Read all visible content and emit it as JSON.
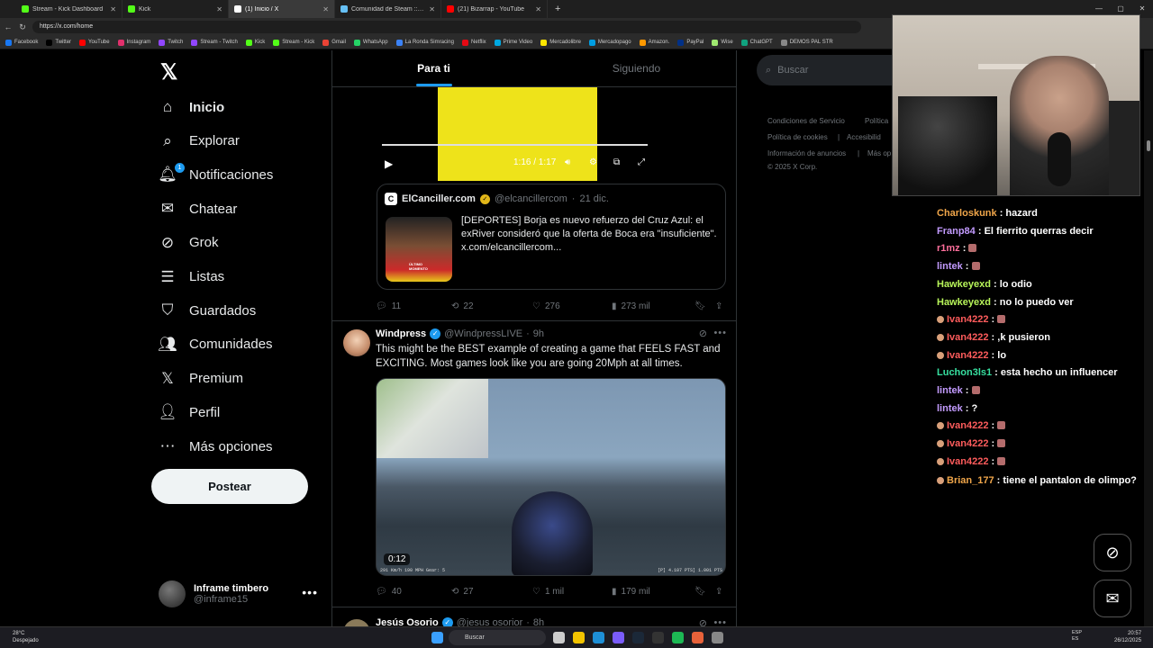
{
  "browser": {
    "tabs": [
      {
        "title": "Stream - Kick Dashboard",
        "active": false,
        "color": "#53fc18"
      },
      {
        "title": "Kick",
        "active": false,
        "color": "#53fc18"
      },
      {
        "title": "(1) Inicio / X",
        "active": true,
        "color": "#ffffff"
      },
      {
        "title": "Comunidad de Steam :: ojo",
        "active": false,
        "color": "#66c0f4"
      },
      {
        "title": "(21) Bizarrap - YouTube",
        "active": false,
        "color": "#ff0000"
      }
    ],
    "url": "https://x.com/home",
    "bookmarks": [
      {
        "label": "Facebook",
        "color": "#1877f2"
      },
      {
        "label": "Twitter",
        "color": "#000000"
      },
      {
        "label": "YouTube",
        "color": "#ff0000"
      },
      {
        "label": "Instagram",
        "color": "#e1306c"
      },
      {
        "label": "Twitch",
        "color": "#9146ff"
      },
      {
        "label": "Stream - Twitch",
        "color": "#9146ff"
      },
      {
        "label": "Kick",
        "color": "#53fc18"
      },
      {
        "label": "Stream - Kick",
        "color": "#53fc18"
      },
      {
        "label": "Gmail",
        "color": "#ea4335"
      },
      {
        "label": "WhatsApp",
        "color": "#25d366"
      },
      {
        "label": "La Ronda Simracing",
        "color": "#3b82f6"
      },
      {
        "label": "Netflix",
        "color": "#e50914"
      },
      {
        "label": "Prime Video",
        "color": "#00a8e1"
      },
      {
        "label": "Mercadolibre",
        "color": "#ffe600"
      },
      {
        "label": "Mercadopago",
        "color": "#009ee3"
      },
      {
        "label": "Amazon.",
        "color": "#ff9900"
      },
      {
        "label": "PayPal",
        "color": "#003087"
      },
      {
        "label": "Wise",
        "color": "#9fe870"
      },
      {
        "label": "ChatGPT",
        "color": "#10a37f"
      },
      {
        "label": "DEMOS PAL STR",
        "color": "#888888"
      }
    ]
  },
  "nav": {
    "items": [
      {
        "label": "Inicio",
        "icon": "home-icon",
        "bold": true
      },
      {
        "label": "Explorar",
        "icon": "search-icon"
      },
      {
        "label": "Notificaciones",
        "icon": "bell-icon",
        "badge": "1"
      },
      {
        "label": "Chatear",
        "icon": "mail-icon"
      },
      {
        "label": "Grok",
        "icon": "grok-icon"
      },
      {
        "label": "Listas",
        "icon": "list-icon"
      },
      {
        "label": "Guardados",
        "icon": "bookmark-icon"
      },
      {
        "label": "Comunidades",
        "icon": "communities-icon"
      },
      {
        "label": "Premium",
        "icon": "x-icon"
      },
      {
        "label": "Perfil",
        "icon": "profile-icon"
      },
      {
        "label": "Más opciones",
        "icon": "more-icon"
      }
    ],
    "post_label": "Postear",
    "account": {
      "name": "Inframe timbero",
      "handle": "@inframe15"
    }
  },
  "feed": {
    "tabs": [
      "Para ti",
      "Siguiendo"
    ],
    "tweet1": {
      "video_time": "1:16 / 1:17",
      "video_progress": 0.99,
      "quote": {
        "name": "ElCanciller.com",
        "handle": "@elcancillercom",
        "date": "21 dic.",
        "text": "[DEPORTES] Borja es nuevo refuerzo del Cruz Azul: el exRiver consideró que la oferta de Boca era \"insuficiente\". x.com/elcancillercom...",
        "thumb_caption": "ÚLTIMO MOMENTO"
      },
      "stats": {
        "replies": "11",
        "reposts": "22",
        "likes": "276",
        "views": "273 mil"
      }
    },
    "tweet2": {
      "name": "Windpress",
      "handle": "@WindpressLIVE",
      "time": "9h",
      "text": "This might be the BEST example of creating a game that FEELS FAST and EXCITING.  Most games look like you are going 20Mph at all times.",
      "video_time": "0:12",
      "hud": [
        "291 Km/h  190 MPH  Gear: 5",
        "[P]  4.107  PTS]  1.001  PTS"
      ],
      "stats": {
        "replies": "40",
        "reposts": "27",
        "likes": "1 mil",
        "views": "179 mil"
      }
    },
    "tweet3": {
      "name": "Jesús Osorio",
      "handle": "@jesus osorior",
      "time": "8h"
    }
  },
  "sidebar": {
    "search_placeholder": "Buscar",
    "legal": [
      "Condiciones de Servicio",
      "Política",
      "Política de cookies",
      "Accesibilid",
      "Información de anuncios",
      "Más op",
      "© 2025 X Corp."
    ]
  },
  "chat": [
    {
      "user": "Charloskunk",
      "color": "#f0a64a",
      "msg": "hazard"
    },
    {
      "user": "Franp84",
      "color": "#c39bff",
      "msg": "El fierrito querras decir"
    },
    {
      "user": "r1mz",
      "color": "#ff6f9c",
      "msg": "",
      "emote": true
    },
    {
      "user": "lintek",
      "color": "#c39bff",
      "msg": "",
      "emote": true
    },
    {
      "user": "Hawkeyexd",
      "color": "#b8f55a",
      "msg": "lo odio"
    },
    {
      "user": "Hawkeyexd",
      "color": "#b8f55a",
      "msg": "no lo puedo ver"
    },
    {
      "user": "Ivan4222",
      "color": "#ff5c5c",
      "msg": "",
      "emote": true,
      "badge": true
    },
    {
      "user": "Ivan4222",
      "color": "#ff5c5c",
      "msg": ",k pusieron",
      "badge": true
    },
    {
      "user": "Ivan4222",
      "color": "#ff5c5c",
      "msg": "lo",
      "badge": true
    },
    {
      "user": "Luchon3ls1",
      "color": "#37e0a0",
      "msg": "esta hecho un influencer"
    },
    {
      "user": "lintek",
      "color": "#c39bff",
      "msg": "",
      "emote": true
    },
    {
      "user": "lintek",
      "color": "#c39bff",
      "msg": "?"
    },
    {
      "user": "Ivan4222",
      "color": "#ff5c5c",
      "msg": "",
      "emote": true,
      "badge": true
    },
    {
      "user": "Ivan4222",
      "color": "#ff5c5c",
      "msg": "",
      "emote": true,
      "badge": true
    },
    {
      "user": "Ivan4222",
      "color": "#ff5c5c",
      "msg": "",
      "emote": true,
      "badge": true
    },
    {
      "user": "Brian_177",
      "color": "#f0a64a",
      "msg": "tiene el pantalon de olimpo?",
      "badge": true
    }
  ],
  "taskbar": {
    "weather_temp": "28°C",
    "weather_desc": "Despejado",
    "search": "Buscar",
    "lang": [
      "ESP",
      "ES"
    ],
    "time": "20:57",
    "date": "26/12/2025"
  }
}
